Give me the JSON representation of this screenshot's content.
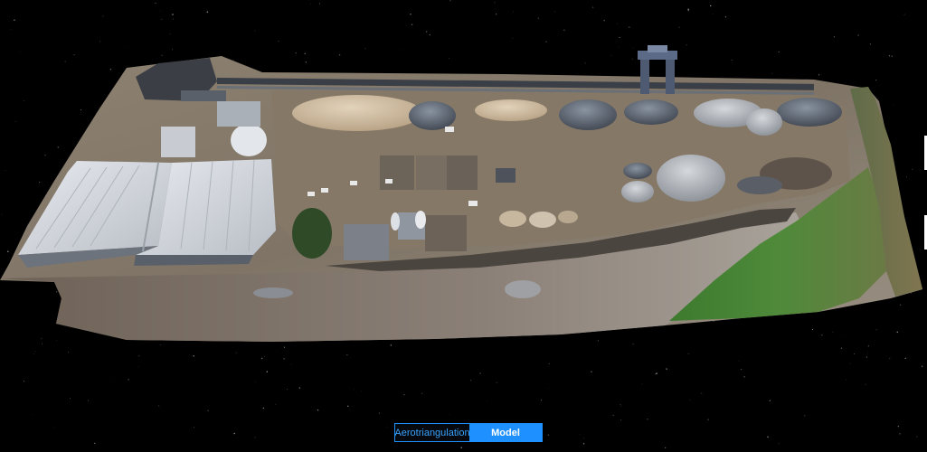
{
  "viewer": {
    "background": "#000000",
    "model_name": "aerial-quarry-site-3d-model"
  },
  "view_toggle": {
    "options": [
      {
        "label": "Aerotriangulation",
        "selected": false
      },
      {
        "label": "Model",
        "selected": true
      }
    ],
    "accent_color": "#1e90ff"
  },
  "icons": {
    "scene": "photogrammetry-mesh-icon"
  }
}
